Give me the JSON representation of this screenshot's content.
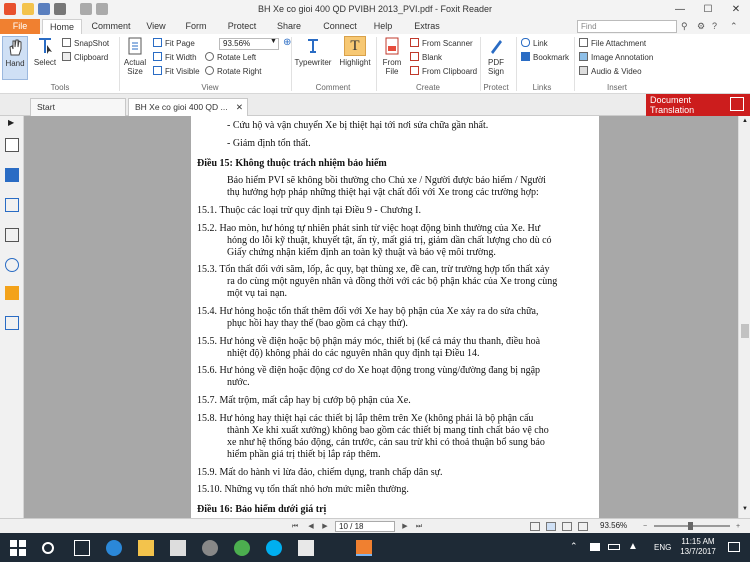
{
  "window": {
    "title": "BH Xe co gioi 400 QD PVIBH 2013_PVI.pdf - Foxit Reader",
    "min": "—",
    "max": "☐",
    "close": "✕"
  },
  "ribbon_tabs": [
    "File",
    "Home",
    "Comment",
    "View",
    "Form",
    "Protect",
    "Share",
    "Connect",
    "Help",
    "Extras"
  ],
  "find": {
    "placeholder": "Find"
  },
  "ribbon": {
    "hand": "Hand",
    "select": "Select",
    "snapshot": "SnapShot",
    "clipboard": "Clipboard",
    "actual_size": "Actual\nSize",
    "fit_page": "Fit Page",
    "fit_width": "Fit Width",
    "fit_visible": "Fit Visible",
    "zoom": "93.56%",
    "zoom_in": "Zoom In",
    "rotate_left": "Rotate Left",
    "rotate_right": "Rotate Right",
    "typewriter": "Typewriter",
    "highlight": "Highlight",
    "from_file": "From\nFile",
    "from_scanner": "From Scanner",
    "blank": "Blank",
    "from_clipboard": "From Clipboard",
    "pdf_sign": "PDF\nSign",
    "link": "Link",
    "bookmark": "Bookmark",
    "file_attachment": "File Attachment",
    "image_annotation": "Image Annotation",
    "audio_video": "Audio & Video",
    "groups": {
      "tools": "Tools",
      "view": "View",
      "comment": "Comment",
      "create": "Create",
      "protect": "Protect",
      "links": "Links",
      "insert": "Insert"
    }
  },
  "doc_tabs": [
    "Start",
    "BH Xe co gioi 400 QD ..."
  ],
  "doc_translation": {
    "line1": "Document",
    "line2": "Translation"
  },
  "document": {
    "lines": [
      "-   Cứu hộ và vận chuyển Xe bị thiệt hại tới nơi sửa chữa gần nhất.",
      "-   Giám định tổn thất.",
      "Điều 15: Không thuộc trách nhiệm bảo hiểm",
      "Bảo hiểm PVI sẽ không bồi thường cho Chủ xe / Người được bảo hiểm / Người",
      "thụ hưởng hợp pháp những thiệt hại vật chất đối với Xe trong các trường hợp:",
      "15.1.   Thuộc các loại trừ quy định tại Điều 9 - Chương I.",
      "15.2.   Hao mòn, hư hỏng tự nhiên phát sinh từ việc hoạt động bình thường của Xe. Hư",
      "hỏng do lỗi kỹ thuật, khuyết tật, ẩn tỳ, mất giá trị, giảm dần chất lượng cho dù có",
      "Giấy chứng nhận kiểm định an toàn kỹ thuật và bảo vệ môi trường.",
      "15.3.   Tổn thất đối với săm, lốp, ắc quy, bạt thùng xe, đề can, trừ trường hợp tổn thất xảy",
      "ra do cùng một nguyên nhân và đồng thời với các bộ phận khác của Xe trong cùng",
      "một vụ tai nạn.",
      "15.4.   Hư hỏng hoặc tổn thất thêm đối với Xe hay bộ phận của Xe xảy ra do sửa chữa,",
      "phục hồi hay thay thế (bao gồm cả chạy thử).",
      "15.5.   Hư hỏng về điện hoặc bộ phận máy móc, thiết bị (kể cả máy thu thanh, điều hoà",
      "nhiệt độ) không phải do các nguyên nhân quy định tại Điều 14.",
      "15.6.   Hư hỏng về điện hoặc động cơ do Xe hoạt động trong vùng/đường đang bị ngập",
      "nước.",
      "15.7.   Mất trộm, mất cắp hay bị cướp bộ phận của Xe.",
      "15.8.   Hư hỏng hay thiệt hại các thiết bị lắp thêm trên Xe (không phải là bộ phận cấu",
      "thành Xe khi xuất xưởng) không bao gồm các thiết bị mang tính chất bảo vệ cho",
      "xe như hệ thống báo động, cản trước, cản sau trừ khi có thoả thuận bổ sung bảo",
      "hiểm phần giá trị thiết bị lắp ráp thêm.",
      "15.9.   Mất do hành vi lừa đảo, chiếm dụng, tranh chấp dân sự.",
      "15.10. Những vụ tổn thất nhỏ hơn mức miễn thường.",
      "Điều 16: Bảo hiểm dưới giá trị"
    ]
  },
  "status": {
    "page": "10 / 18",
    "zoom": "93.56%"
  },
  "taskbar": {
    "lang": "ENG",
    "time": "11:15 AM",
    "date": "13/7/2017"
  }
}
